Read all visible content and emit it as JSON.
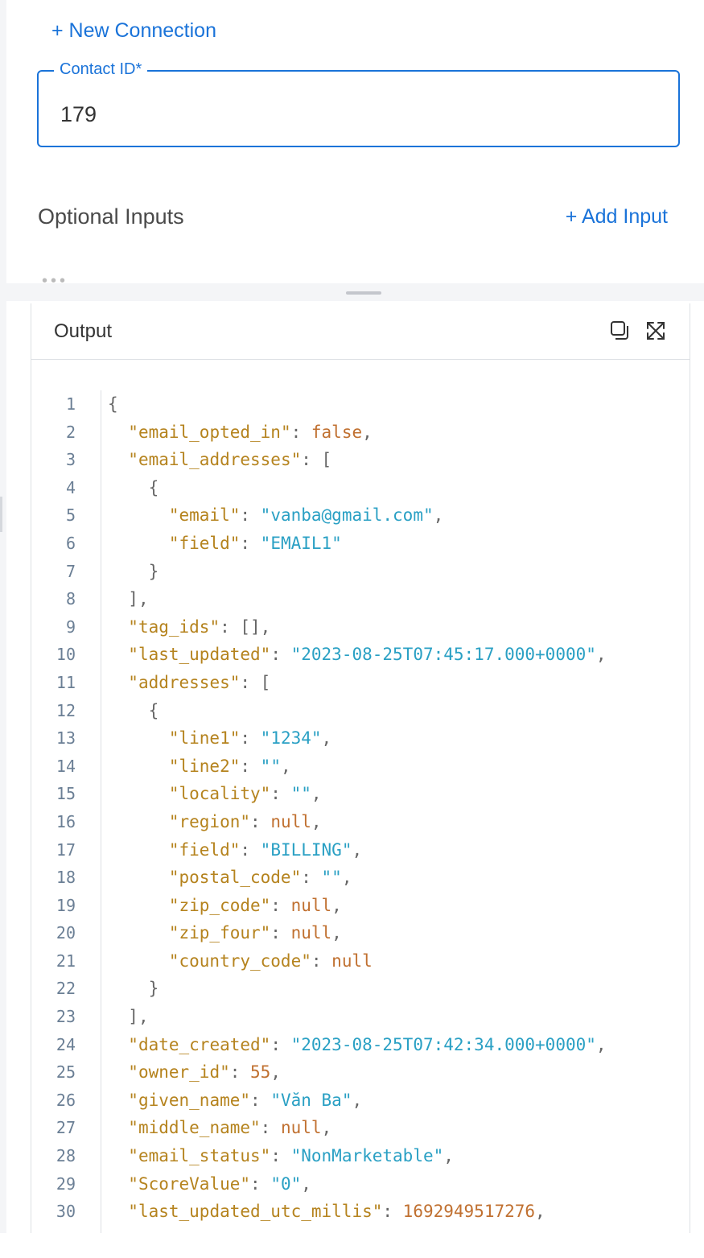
{
  "top": {
    "new_connection_label": "+ New Connection",
    "contact_field": {
      "label": "Contact ID*",
      "value": "179"
    },
    "optional_inputs_title": "Optional Inputs",
    "add_input_label": "+ Add Input"
  },
  "output": {
    "title": "Output",
    "icons": [
      "copy-icon",
      "expand-icon"
    ],
    "lines": [
      {
        "n": "1",
        "indent": 0,
        "tokens": [
          {
            "t": "p",
            "v": "{"
          }
        ]
      },
      {
        "n": "2",
        "indent": 1,
        "tokens": [
          {
            "t": "k",
            "v": "\"email_opted_in\""
          },
          {
            "t": "p",
            "v": ": "
          },
          {
            "t": "b",
            "v": "false"
          },
          {
            "t": "p",
            "v": ","
          }
        ]
      },
      {
        "n": "3",
        "indent": 1,
        "tokens": [
          {
            "t": "k",
            "v": "\"email_addresses\""
          },
          {
            "t": "p",
            "v": ": ["
          }
        ]
      },
      {
        "n": "4",
        "indent": 2,
        "tokens": [
          {
            "t": "p",
            "v": "{"
          }
        ]
      },
      {
        "n": "5",
        "indent": 3,
        "tokens": [
          {
            "t": "k",
            "v": "\"email\""
          },
          {
            "t": "p",
            "v": ": "
          },
          {
            "t": "s",
            "v": "\"vanba@gmail.com\""
          },
          {
            "t": "p",
            "v": ","
          }
        ]
      },
      {
        "n": "6",
        "indent": 3,
        "tokens": [
          {
            "t": "k",
            "v": "\"field\""
          },
          {
            "t": "p",
            "v": ": "
          },
          {
            "t": "s",
            "v": "\"EMAIL1\""
          }
        ]
      },
      {
        "n": "7",
        "indent": 2,
        "tokens": [
          {
            "t": "p",
            "v": "}"
          }
        ]
      },
      {
        "n": "8",
        "indent": 1,
        "tokens": [
          {
            "t": "p",
            "v": "],"
          }
        ]
      },
      {
        "n": "9",
        "indent": 1,
        "tokens": [
          {
            "t": "k",
            "v": "\"tag_ids\""
          },
          {
            "t": "p",
            "v": ": [],"
          }
        ]
      },
      {
        "n": "10",
        "indent": 1,
        "tokens": [
          {
            "t": "k",
            "v": "\"last_updated\""
          },
          {
            "t": "p",
            "v": ": "
          },
          {
            "t": "s",
            "v": "\"2023-08-25T07:45:17.000+0000\""
          },
          {
            "t": "p",
            "v": ","
          }
        ]
      },
      {
        "n": "11",
        "indent": 1,
        "tokens": [
          {
            "t": "k",
            "v": "\"addresses\""
          },
          {
            "t": "p",
            "v": ": ["
          }
        ]
      },
      {
        "n": "12",
        "indent": 2,
        "tokens": [
          {
            "t": "p",
            "v": "{"
          }
        ]
      },
      {
        "n": "13",
        "indent": 3,
        "tokens": [
          {
            "t": "k",
            "v": "\"line1\""
          },
          {
            "t": "p",
            "v": ": "
          },
          {
            "t": "s",
            "v": "\"1234\""
          },
          {
            "t": "p",
            "v": ","
          }
        ]
      },
      {
        "n": "14",
        "indent": 3,
        "tokens": [
          {
            "t": "k",
            "v": "\"line2\""
          },
          {
            "t": "p",
            "v": ": "
          },
          {
            "t": "s",
            "v": "\"\""
          },
          {
            "t": "p",
            "v": ","
          }
        ]
      },
      {
        "n": "15",
        "indent": 3,
        "tokens": [
          {
            "t": "k",
            "v": "\"locality\""
          },
          {
            "t": "p",
            "v": ": "
          },
          {
            "t": "s",
            "v": "\"\""
          },
          {
            "t": "p",
            "v": ","
          }
        ]
      },
      {
        "n": "16",
        "indent": 3,
        "tokens": [
          {
            "t": "k",
            "v": "\"region\""
          },
          {
            "t": "p",
            "v": ": "
          },
          {
            "t": "b",
            "v": "null"
          },
          {
            "t": "p",
            "v": ","
          }
        ]
      },
      {
        "n": "17",
        "indent": 3,
        "tokens": [
          {
            "t": "k",
            "v": "\"field\""
          },
          {
            "t": "p",
            "v": ": "
          },
          {
            "t": "s",
            "v": "\"BILLING\""
          },
          {
            "t": "p",
            "v": ","
          }
        ]
      },
      {
        "n": "18",
        "indent": 3,
        "tokens": [
          {
            "t": "k",
            "v": "\"postal_code\""
          },
          {
            "t": "p",
            "v": ": "
          },
          {
            "t": "s",
            "v": "\"\""
          },
          {
            "t": "p",
            "v": ","
          }
        ]
      },
      {
        "n": "19",
        "indent": 3,
        "tokens": [
          {
            "t": "k",
            "v": "\"zip_code\""
          },
          {
            "t": "p",
            "v": ": "
          },
          {
            "t": "b",
            "v": "null"
          },
          {
            "t": "p",
            "v": ","
          }
        ]
      },
      {
        "n": "20",
        "indent": 3,
        "tokens": [
          {
            "t": "k",
            "v": "\"zip_four\""
          },
          {
            "t": "p",
            "v": ": "
          },
          {
            "t": "b",
            "v": "null"
          },
          {
            "t": "p",
            "v": ","
          }
        ]
      },
      {
        "n": "21",
        "indent": 3,
        "tokens": [
          {
            "t": "k",
            "v": "\"country_code\""
          },
          {
            "t": "p",
            "v": ": "
          },
          {
            "t": "b",
            "v": "null"
          }
        ]
      },
      {
        "n": "22",
        "indent": 2,
        "tokens": [
          {
            "t": "p",
            "v": "}"
          }
        ]
      },
      {
        "n": "23",
        "indent": 1,
        "tokens": [
          {
            "t": "p",
            "v": "],"
          }
        ]
      },
      {
        "n": "24",
        "indent": 1,
        "tokens": [
          {
            "t": "k",
            "v": "\"date_created\""
          },
          {
            "t": "p",
            "v": ": "
          },
          {
            "t": "s",
            "v": "\"2023-08-25T07:42:34.000+0000\""
          },
          {
            "t": "p",
            "v": ","
          }
        ]
      },
      {
        "n": "25",
        "indent": 1,
        "tokens": [
          {
            "t": "k",
            "v": "\"owner_id\""
          },
          {
            "t": "p",
            "v": ": "
          },
          {
            "t": "n",
            "v": "55"
          },
          {
            "t": "p",
            "v": ","
          }
        ]
      },
      {
        "n": "26",
        "indent": 1,
        "tokens": [
          {
            "t": "k",
            "v": "\"given_name\""
          },
          {
            "t": "p",
            "v": ": "
          },
          {
            "t": "s",
            "v": "\"Văn Ba\""
          },
          {
            "t": "p",
            "v": ","
          }
        ]
      },
      {
        "n": "27",
        "indent": 1,
        "tokens": [
          {
            "t": "k",
            "v": "\"middle_name\""
          },
          {
            "t": "p",
            "v": ": "
          },
          {
            "t": "b",
            "v": "null"
          },
          {
            "t": "p",
            "v": ","
          }
        ]
      },
      {
        "n": "28",
        "indent": 1,
        "tokens": [
          {
            "t": "k",
            "v": "\"email_status\""
          },
          {
            "t": "p",
            "v": ": "
          },
          {
            "t": "s",
            "v": "\"NonMarketable\""
          },
          {
            "t": "p",
            "v": ","
          }
        ]
      },
      {
        "n": "29",
        "indent": 1,
        "tokens": [
          {
            "t": "k",
            "v": "\"ScoreValue\""
          },
          {
            "t": "p",
            "v": ": "
          },
          {
            "t": "s",
            "v": "\"0\""
          },
          {
            "t": "p",
            "v": ","
          }
        ]
      },
      {
        "n": "30",
        "indent": 1,
        "tokens": [
          {
            "t": "k",
            "v": "\"last_updated_utc_millis\""
          },
          {
            "t": "p",
            "v": ": "
          },
          {
            "t": "n",
            "v": "1692949517276"
          },
          {
            "t": "p",
            "v": ","
          }
        ]
      }
    ]
  },
  "colors": {
    "accent": "#1a73d9",
    "json_key": "#b5831e",
    "json_string": "#2aa0c4",
    "json_literal": "#c07030"
  }
}
